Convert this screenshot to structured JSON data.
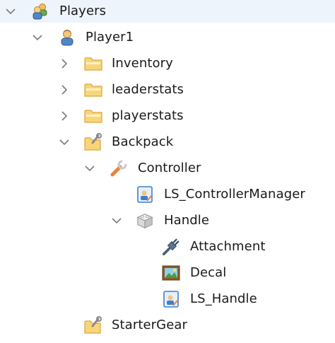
{
  "tree": {
    "players": {
      "label": "Players",
      "icon": "players-icon",
      "expanded": true
    },
    "player1": {
      "label": "Player1",
      "icon": "player-icon",
      "expanded": true
    },
    "inventory": {
      "label": "Inventory",
      "icon": "folder-icon",
      "expanded": false
    },
    "leaderstats": {
      "label": "leaderstats",
      "icon": "folder-icon",
      "expanded": false
    },
    "playerstats": {
      "label": "playerstats",
      "icon": "folder-icon",
      "expanded": false
    },
    "backpack": {
      "label": "Backpack",
      "icon": "backpack-folder-icon",
      "expanded": true
    },
    "controller": {
      "label": "Controller",
      "icon": "tool-icon",
      "expanded": true
    },
    "ls_controllermanager": {
      "label": "LS_ControllerManager",
      "icon": "localscript-icon"
    },
    "handle": {
      "label": "Handle",
      "icon": "part-icon",
      "expanded": true
    },
    "attachment": {
      "label": "Attachment",
      "icon": "attachment-icon"
    },
    "decal": {
      "label": "Decal",
      "icon": "decal-icon"
    },
    "ls_handle": {
      "label": "LS_Handle",
      "icon": "localscript-icon"
    },
    "startergear": {
      "label": "StarterGear",
      "icon": "startergear-folder-icon"
    }
  },
  "colors": {
    "folder_fill": "#f7d67a",
    "folder_stroke": "#d9a63b",
    "tool_orange": "#e8833a",
    "script_blue": "#3c7fd1",
    "arrow_gray": "#7a7a7a"
  }
}
